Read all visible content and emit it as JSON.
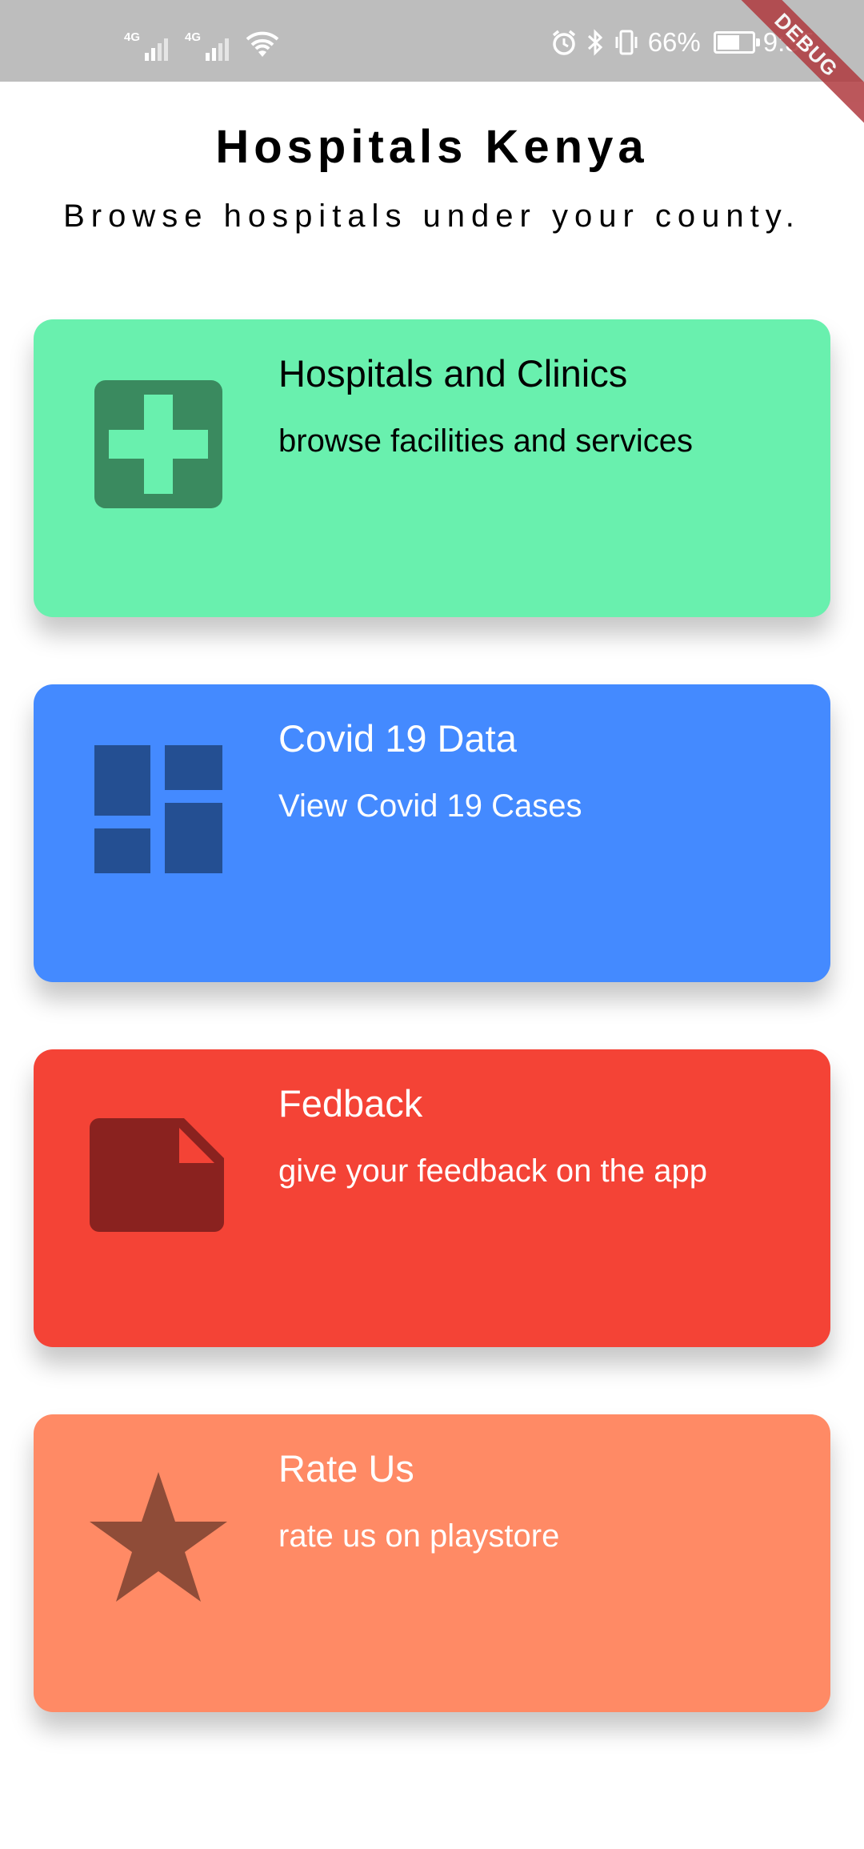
{
  "status_bar": {
    "network1": "4G",
    "network2": "4G",
    "battery_percent": "66%",
    "battery_level": 0.66,
    "time": "9:35"
  },
  "debug_banner": "DEBUG",
  "header": {
    "title": "Hospitals Kenya",
    "subtitle": "Browse hospitals under your county."
  },
  "cards": [
    {
      "title": "Hospitals and Clinics",
      "description": "browse facilities and services",
      "icon": "local-hospital-icon",
      "background": "#69F0AE",
      "icon_color": "#3A8A5F",
      "text_color": "#000000"
    },
    {
      "title": "Covid 19 Data",
      "description": "View Covid 19 Cases",
      "icon": "dashboard-icon",
      "background": "#448AFF",
      "icon_color": "#244F92",
      "text_color": "#FFFFFF"
    },
    {
      "title": "Fedback",
      "description": "give your feedback on the app",
      "icon": "note-icon",
      "background": "#F44336",
      "icon_color": "#8A221F",
      "text_color": "#FFFFFF"
    },
    {
      "title": "Rate Us",
      "description": "rate us on playstore",
      "icon": "star-icon",
      "background": "#FF8A65",
      "icon_color": "#8F4C38",
      "text_color": "#FFFFFF"
    }
  ]
}
